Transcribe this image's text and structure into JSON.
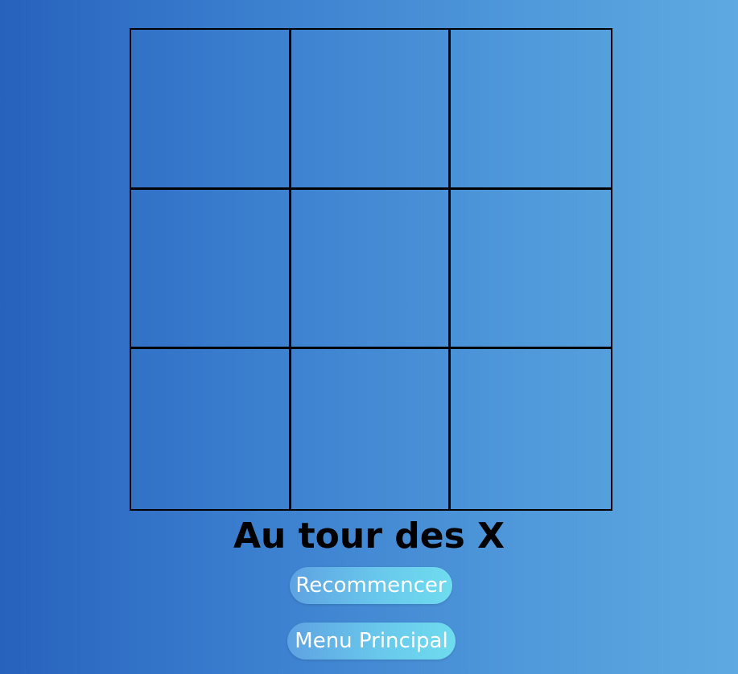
{
  "game": {
    "board": {
      "cells": [
        "",
        "",
        "",
        "",
        "",
        "",
        "",
        "",
        ""
      ]
    },
    "status_text": "Au tour des X"
  },
  "buttons": {
    "restart_label": "Recommencer",
    "menu_label": "Menu Principal"
  },
  "colors": {
    "background_left": "#2762bd",
    "background_right": "#5ea9e1",
    "grid_lines": "#000000",
    "button_start": "#5ea2e2",
    "button_end": "#6fdcee",
    "button_text": "#ffffff"
  }
}
